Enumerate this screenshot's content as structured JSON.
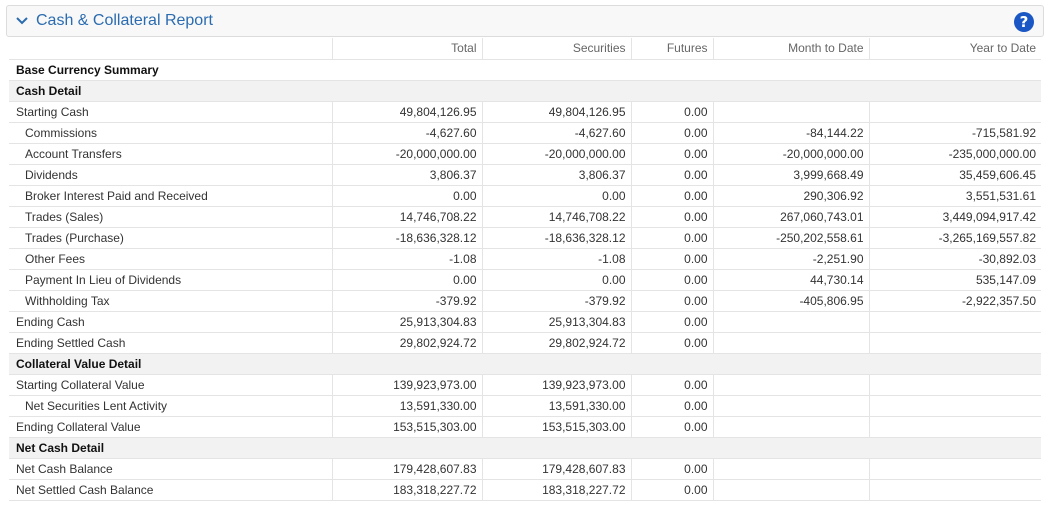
{
  "header": {
    "title": "Cash & Collateral Report",
    "help_label": "?"
  },
  "columns": [
    "",
    "Total",
    "Securities",
    "Futures",
    "Month to Date",
    "Year to Date"
  ],
  "summary_label": "Base Currency Summary",
  "sections": [
    {
      "title": "Cash Detail",
      "rows": [
        {
          "label": "Starting Cash",
          "indent": false,
          "total": "49,804,126.95",
          "securities": "49,804,126.95",
          "futures": "0.00",
          "mtd": "",
          "ytd": ""
        },
        {
          "label": "Commissions",
          "indent": true,
          "total": "-4,627.60",
          "securities": "-4,627.60",
          "futures": "0.00",
          "mtd": "-84,144.22",
          "ytd": "-715,581.92"
        },
        {
          "label": "Account Transfers",
          "indent": true,
          "total": "-20,000,000.00",
          "securities": "-20,000,000.00",
          "futures": "0.00",
          "mtd": "-20,000,000.00",
          "ytd": "-235,000,000.00"
        },
        {
          "label": "Dividends",
          "indent": true,
          "total": "3,806.37",
          "securities": "3,806.37",
          "futures": "0.00",
          "mtd": "3,999,668.49",
          "ytd": "35,459,606.45"
        },
        {
          "label": "Broker Interest Paid and Received",
          "indent": true,
          "total": "0.00",
          "securities": "0.00",
          "futures": "0.00",
          "mtd": "290,306.92",
          "ytd": "3,551,531.61"
        },
        {
          "label": "Trades (Sales)",
          "indent": true,
          "total": "14,746,708.22",
          "securities": "14,746,708.22",
          "futures": "0.00",
          "mtd": "267,060,743.01",
          "ytd": "3,449,094,917.42"
        },
        {
          "label": "Trades (Purchase)",
          "indent": true,
          "total": "-18,636,328.12",
          "securities": "-18,636,328.12",
          "futures": "0.00",
          "mtd": "-250,202,558.61",
          "ytd": "-3,265,169,557.82"
        },
        {
          "label": "Other Fees",
          "indent": true,
          "total": "-1.08",
          "securities": "-1.08",
          "futures": "0.00",
          "mtd": "-2,251.90",
          "ytd": "-30,892.03"
        },
        {
          "label": "Payment In Lieu of Dividends",
          "indent": true,
          "total": "0.00",
          "securities": "0.00",
          "futures": "0.00",
          "mtd": "44,730.14",
          "ytd": "535,147.09"
        },
        {
          "label": "Withholding Tax",
          "indent": true,
          "total": "-379.92",
          "securities": "-379.92",
          "futures": "0.00",
          "mtd": "-405,806.95",
          "ytd": "-2,922,357.50"
        },
        {
          "label": "Ending Cash",
          "indent": false,
          "total": "25,913,304.83",
          "securities": "25,913,304.83",
          "futures": "0.00",
          "mtd": "",
          "ytd": ""
        },
        {
          "label": "Ending Settled Cash",
          "indent": false,
          "total": "29,802,924.72",
          "securities": "29,802,924.72",
          "futures": "0.00",
          "mtd": "",
          "ytd": ""
        }
      ]
    },
    {
      "title": "Collateral Value Detail",
      "rows": [
        {
          "label": "Starting Collateral Value",
          "indent": false,
          "total": "139,923,973.00",
          "securities": "139,923,973.00",
          "futures": "0.00",
          "mtd": "",
          "ytd": ""
        },
        {
          "label": "Net Securities Lent Activity",
          "indent": true,
          "total": "13,591,330.00",
          "securities": "13,591,330.00",
          "futures": "0.00",
          "mtd": "",
          "ytd": ""
        },
        {
          "label": "Ending Collateral Value",
          "indent": false,
          "total": "153,515,303.00",
          "securities": "153,515,303.00",
          "futures": "0.00",
          "mtd": "",
          "ytd": ""
        }
      ]
    },
    {
      "title": "Net Cash Detail",
      "rows": [
        {
          "label": "Net Cash Balance",
          "indent": false,
          "total": "179,428,607.83",
          "securities": "179,428,607.83",
          "futures": "0.00",
          "mtd": "",
          "ytd": ""
        },
        {
          "label": "Net Settled Cash Balance",
          "indent": false,
          "total": "183,318,227.72",
          "securities": "183,318,227.72",
          "futures": "0.00",
          "mtd": "",
          "ytd": ""
        }
      ]
    }
  ]
}
